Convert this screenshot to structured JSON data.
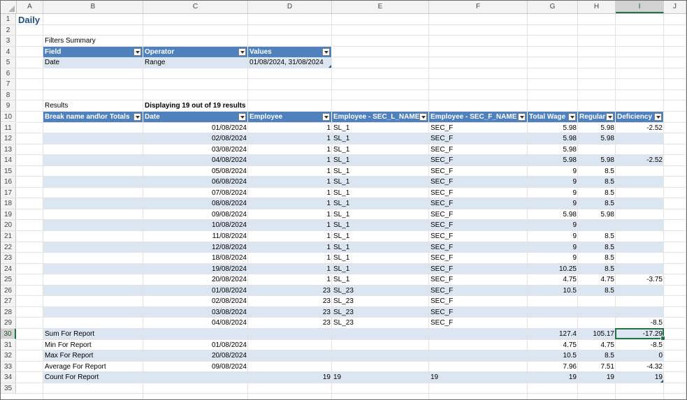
{
  "columns": [
    "A",
    "B",
    "C",
    "D",
    "E",
    "F",
    "G",
    "H",
    "I",
    "J"
  ],
  "rows": [
    "1",
    "2",
    "3",
    "4",
    "5",
    "6",
    "7",
    "8",
    "9",
    "10",
    "11",
    "12",
    "13",
    "14",
    "15",
    "16",
    "17",
    "18",
    "19",
    "20",
    "21",
    "22",
    "23",
    "24",
    "25",
    "26",
    "27",
    "28",
    "29",
    "30",
    "31",
    "32",
    "33",
    "34",
    "35"
  ],
  "selected_column": "I",
  "selected_row": "30",
  "sheet": {
    "title": "Daily",
    "filters_label": "Filters Summary",
    "filters_headers": [
      "Field",
      "Operator",
      "Values"
    ],
    "filters_row": [
      "Date",
      "Range",
      "01/08/2024, 31/08/2024"
    ],
    "results_label": "Results",
    "results_count": "Displaying 19 out of 19 results",
    "table_headers": [
      "Break name and\\or Totals",
      "Date",
      "Employee",
      "Employee - SEC_L_NAME",
      "Employee - SEC_F_NAME",
      "Total Wage",
      "Regular",
      "Deficiency"
    ],
    "table_rows": [
      [
        "",
        "01/08/2024",
        "1",
        "SL_1",
        "SEC_F",
        "5.98",
        "5.98",
        "-2.52"
      ],
      [
        "",
        "02/08/2024",
        "1",
        "SL_1",
        "SEC_F",
        "5.98",
        "5.98",
        ""
      ],
      [
        "",
        "03/08/2024",
        "1",
        "SL_1",
        "SEC_F",
        "5.98",
        "",
        ""
      ],
      [
        "",
        "04/08/2024",
        "1",
        "SL_1",
        "SEC_F",
        "5.98",
        "5.98",
        "-2.52"
      ],
      [
        "",
        "05/08/2024",
        "1",
        "SL_1",
        "SEC_F",
        "9",
        "8.5",
        ""
      ],
      [
        "",
        "06/08/2024",
        "1",
        "SL_1",
        "SEC_F",
        "9",
        "8.5",
        ""
      ],
      [
        "",
        "07/08/2024",
        "1",
        "SL_1",
        "SEC_F",
        "9",
        "8.5",
        ""
      ],
      [
        "",
        "08/08/2024",
        "1",
        "SL_1",
        "SEC_F",
        "9",
        "8.5",
        ""
      ],
      [
        "",
        "09/08/2024",
        "1",
        "SL_1",
        "SEC_F",
        "5.98",
        "5.98",
        ""
      ],
      [
        "",
        "10/08/2024",
        "1",
        "SL_1",
        "SEC_F",
        "9",
        "",
        ""
      ],
      [
        "",
        "11/08/2024",
        "1",
        "SL_1",
        "SEC_F",
        "9",
        "8.5",
        ""
      ],
      [
        "",
        "12/08/2024",
        "1",
        "SL_1",
        "SEC_F",
        "9",
        "8.5",
        ""
      ],
      [
        "",
        "18/08/2024",
        "1",
        "SL_1",
        "SEC_F",
        "9",
        "8.5",
        ""
      ],
      [
        "",
        "19/08/2024",
        "1",
        "SL_1",
        "SEC_F",
        "10.25",
        "8.5",
        ""
      ],
      [
        "",
        "20/08/2024",
        "1",
        "SL_1",
        "SEC_F",
        "4.75",
        "4.75",
        "-3.75"
      ],
      [
        "",
        "01/08/2024",
        "23",
        "SL_23",
        "SEC_F",
        "10.5",
        "8.5",
        ""
      ],
      [
        "",
        "02/08/2024",
        "23",
        "SL_23",
        "SEC_F",
        "",
        "",
        ""
      ],
      [
        "",
        "03/08/2024",
        "23",
        "SL_23",
        "SEC_F",
        "",
        "",
        ""
      ],
      [
        "",
        "04/08/2024",
        "23",
        "SL_23",
        "SEC_F",
        "",
        "",
        "-8.5"
      ],
      [
        "Sum For Report",
        "",
        "",
        "",
        "",
        "127.4",
        "105.17",
        "-17.29"
      ],
      [
        "Min For Report",
        "01/08/2024",
        "",
        "",
        "",
        "4.75",
        "4.75",
        "-8.5"
      ],
      [
        "Max For Report",
        "20/08/2024",
        "",
        "",
        "",
        "10.5",
        "8.5",
        "0"
      ],
      [
        "Average For Report",
        "09/08/2024",
        "",
        "",
        "",
        "7.96",
        "7.51",
        "-4.32"
      ],
      [
        "Count For Report",
        "",
        "19",
        "19",
        "19",
        "19",
        "19",
        "19"
      ]
    ]
  },
  "colors": {
    "header_fill": "#4f81bd",
    "band_fill": "#dce6f1",
    "selection": "#217346",
    "title": "#1f4e79"
  }
}
